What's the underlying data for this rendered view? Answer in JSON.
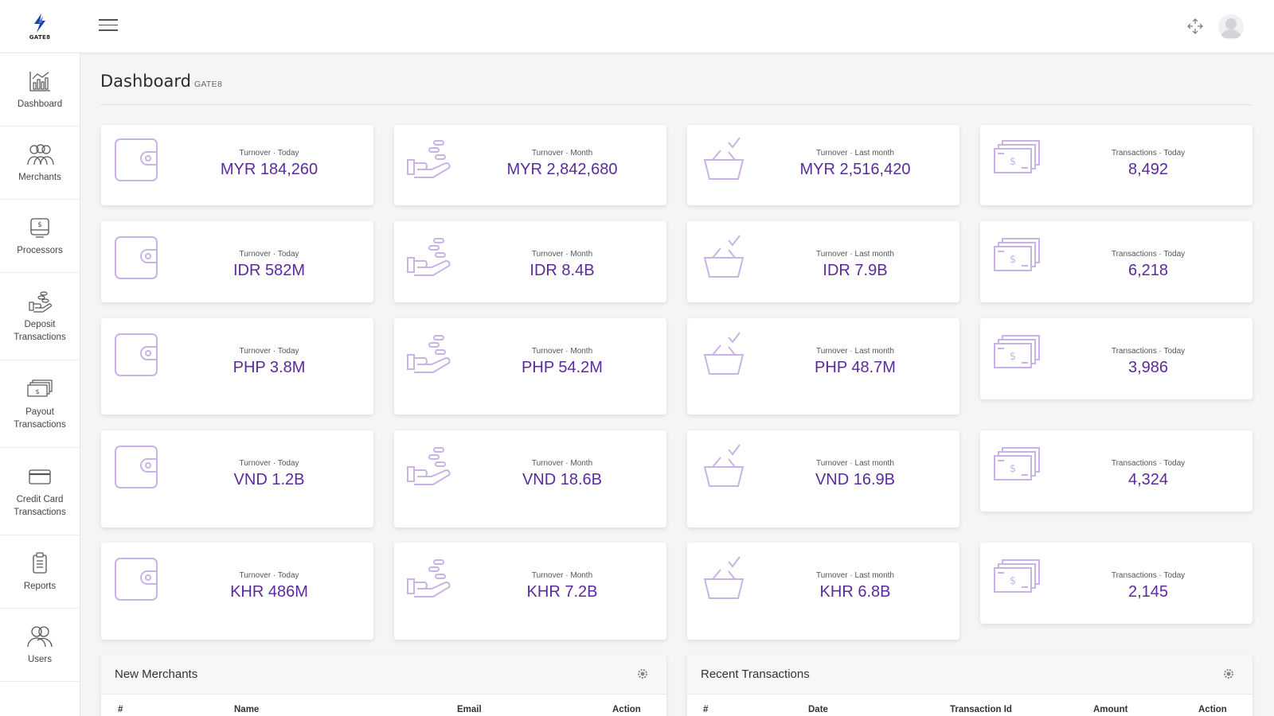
{
  "app": {
    "brand": "GATE8"
  },
  "page": {
    "title": "Dashboard",
    "subtitle": "GATE8"
  },
  "sidebar": {
    "items": [
      {
        "label": "Dashboard",
        "icon": "bar-chart-icon"
      },
      {
        "label": "Merchants",
        "icon": "people-icon"
      },
      {
        "label": "Processors",
        "icon": "cash-register-icon"
      },
      {
        "label": "Deposit Transactions",
        "icon": "hand-coins-icon"
      },
      {
        "label": "Payout Transactions",
        "icon": "banknotes-icon"
      },
      {
        "label": "Credit Card Transactions",
        "icon": "credit-card-icon"
      },
      {
        "label": "Reports",
        "icon": "clipboard-icon"
      },
      {
        "label": "Users",
        "icon": "users-icon"
      }
    ]
  },
  "accent_color": "#5b2a9e",
  "icon_color": "#c9b3e6",
  "stats": {
    "rows": [
      [
        {
          "label": "Turnover · Today",
          "value": "MYR 184,260",
          "icon": "wallet-icon"
        },
        {
          "label": "Turnover · Month",
          "value": "MYR 2,842,680",
          "icon": "hand-coins-icon"
        },
        {
          "label": "Turnover · Last month",
          "value": "MYR 2,516,420",
          "icon": "basket-check-icon"
        },
        {
          "label": "Transactions · Today",
          "value": "8,492",
          "icon": "money-stack-icon"
        }
      ],
      [
        {
          "label": "Turnover · Today",
          "value": "IDR 582M",
          "icon": "wallet-icon"
        },
        {
          "label": "Turnover · Month",
          "value": "IDR 8.4B",
          "icon": "hand-coins-icon"
        },
        {
          "label": "Turnover · Last month",
          "value": "IDR 7.9B",
          "icon": "basket-check-icon"
        },
        {
          "label": "Transactions · Today",
          "value": "6,218",
          "icon": "money-stack-icon"
        }
      ],
      [
        {
          "label": "Turnover · Today",
          "value": "PHP 3.8M",
          "icon": "wallet-icon"
        },
        {
          "label": "Turnover · Month",
          "value": "PHP 54.2M",
          "icon": "hand-coins-icon"
        },
        {
          "label": "Turnover · Last month",
          "value": "PHP 48.7M",
          "icon": "basket-check-icon"
        },
        {
          "label": "Transactions · Today",
          "value": "3,986",
          "icon": "money-stack-icon"
        }
      ],
      [
        {
          "label": "Turnover · Today",
          "value": "VND 1.2B",
          "icon": "wallet-icon"
        },
        {
          "label": "Turnover · Month",
          "value": "VND 18.6B",
          "icon": "hand-coins-icon"
        },
        {
          "label": "Turnover · Last month",
          "value": "VND 16.9B",
          "icon": "basket-check-icon"
        },
        {
          "label": "Transactions · Today",
          "value": "4,324",
          "icon": "money-stack-icon"
        }
      ],
      [
        {
          "label": "Turnover · Today",
          "value": "KHR 486M",
          "icon": "wallet-icon"
        },
        {
          "label": "Turnover · Month",
          "value": "KHR 7.2B",
          "icon": "hand-coins-icon"
        },
        {
          "label": "Turnover · Last month",
          "value": "KHR 6.8B",
          "icon": "basket-check-icon"
        },
        {
          "label": "Transactions · Today",
          "value": "2,145",
          "icon": "money-stack-icon"
        }
      ]
    ]
  },
  "new_merchants": {
    "title": "New Merchants",
    "columns": [
      "#",
      "Name",
      "Email",
      "Action"
    ]
  },
  "recent_transactions": {
    "title": "Recent Transactions",
    "columns": [
      "#",
      "Date",
      "Transaction Id",
      "Amount",
      "Action"
    ]
  }
}
